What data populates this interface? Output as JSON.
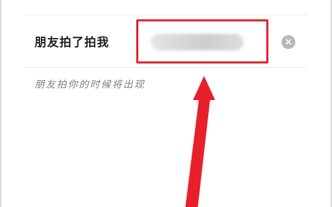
{
  "setting": {
    "label": "朋友拍了拍我",
    "value": "",
    "clear_icon": "clear-circle-icon",
    "clear_glyph": "×"
  },
  "hint": {
    "text": "朋友拍你的时候将出现"
  },
  "annotation": {
    "highlight_color": "#e8202b",
    "arrow_color": "#e8202b"
  }
}
